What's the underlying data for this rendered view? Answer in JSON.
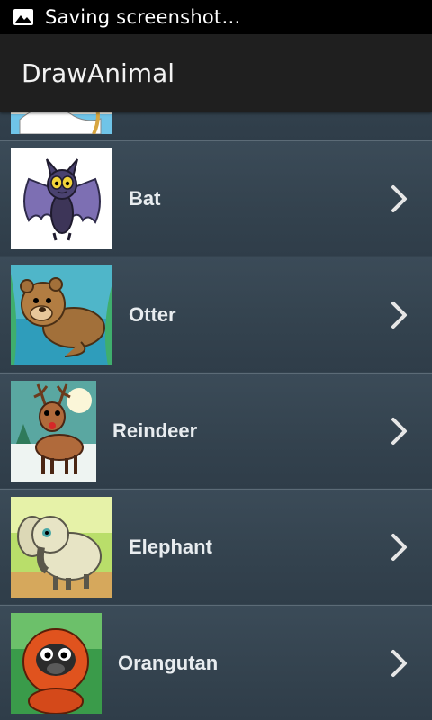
{
  "status_bar": {
    "notification_icon": "image-icon",
    "text": "Saving screenshot…"
  },
  "action_bar": {
    "title": "DrawAnimal"
  },
  "list": {
    "items": [
      {
        "label": "",
        "icon": "bird-picture"
      },
      {
        "label": "Bat",
        "icon": "bat-picture"
      },
      {
        "label": "Otter",
        "icon": "otter-picture"
      },
      {
        "label": "Reindeer",
        "icon": "reindeer-picture"
      },
      {
        "label": "Elephant",
        "icon": "elephant-picture"
      },
      {
        "label": "Orangutan",
        "icon": "orangutan-picture"
      }
    ],
    "chevron_icon": "chevron-right-icon"
  },
  "colors": {
    "status_bar": "#000000",
    "action_bar": "#1f1f1f",
    "list_background": "#34434f",
    "divider": "#5c6b77",
    "text": "#e8ecef"
  }
}
